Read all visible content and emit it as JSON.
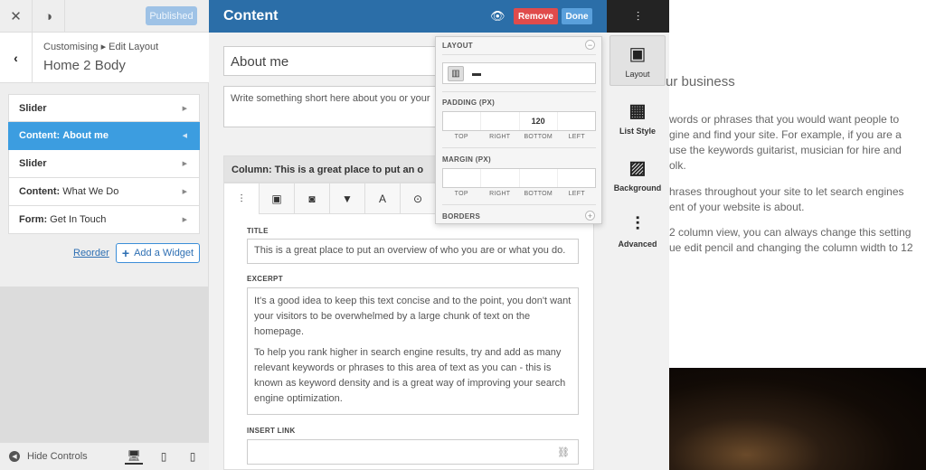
{
  "topbar": {
    "close_icon": "close-icon",
    "wp_icon": "wordpress-icon",
    "published_label": "Published"
  },
  "crumbs": {
    "parent": "Customising ▸ Edit Layout",
    "title": "Home 2 Body"
  },
  "widgets": [
    {
      "type": "Slider",
      "name": "",
      "active": false
    },
    {
      "type": "Content:",
      "name": "About me",
      "active": true
    },
    {
      "type": "Slider",
      "name": "",
      "active": false
    },
    {
      "type": "Content:",
      "name": "What We Do",
      "active": false
    },
    {
      "type": "Form:",
      "name": "Get In Touch",
      "active": false
    }
  ],
  "actions": {
    "reorder": "Reorder",
    "add_widget": "Add a Widget"
  },
  "footer": {
    "hide_controls": "Hide Controls"
  },
  "editor": {
    "title": "Content",
    "remove": "Remove",
    "done": "Done",
    "widget_title": "About me",
    "widget_desc": "Write something short here about you or your",
    "column_head": "Column: This is a great place to put an o",
    "title_label": "TITLE",
    "title_value": "This is a great place to put an overview of who you are or what you do.",
    "excerpt_label": "EXCERPT",
    "excerpt_p1": "It's a good idea to keep this text concise and to the point, you don't want your visitors to be overwhelmed by a large chunk of text on the homepage.",
    "excerpt_p2": "To help you rank higher in search engine results, try and add as many relevant keywords or phrases to this area of text as you can - this is known as keyword density and is a great way of improving your search engine optimization.",
    "insert_link_label": "INSERT LINK"
  },
  "popup": {
    "layout": "LAYOUT",
    "padding": "PADDING (PX)",
    "margin": "MARGIN (PX)",
    "borders": "BORDERS",
    "padding_values": [
      "",
      "",
      "120",
      ""
    ],
    "margin_values": [
      "",
      "",
      "",
      ""
    ],
    "sides": [
      "TOP",
      "RIGHT",
      "BOTTOM",
      "LEFT"
    ]
  },
  "rtabs": [
    "Layout",
    "List Style",
    "Background",
    "Advanced"
  ],
  "preview": {
    "heading": "ur business",
    "lines": [
      "words or phrases that you would want people to",
      "gine and find your site. For example, if you are a",
      "use the keywords guitarist, musician for hire and",
      "olk.",
      "hrases throughout your site to let search engines",
      "ent of your website is about.",
      "2 column view, you can always change this setting",
      "ue edit pencil and changing the column width to 12"
    ]
  }
}
